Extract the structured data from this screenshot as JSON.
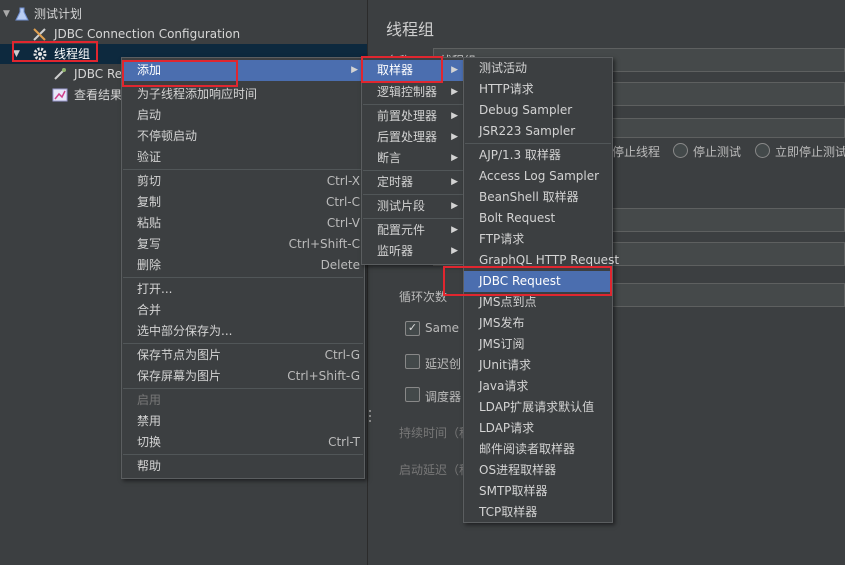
{
  "tree": {
    "items": [
      {
        "label": "测试计划",
        "icon": "flask-icon"
      },
      {
        "label": "JDBC Connection Configuration",
        "icon": "tools-icon"
      },
      {
        "label": "线程组",
        "icon": "gear-icon"
      },
      {
        "label": "JDBC Req",
        "icon": "pipette-icon"
      },
      {
        "label": "查看结果",
        "icon": "chart-icon"
      }
    ]
  },
  "right_panel": {
    "title": "线程组",
    "name_label": "名称",
    "name_value": "线程组",
    "radio_stop_thread": "停止线程",
    "radio_stop_test": "停止测试",
    "radio_stop_now": "立即停止测试",
    "loop_count_label": "循环次数",
    "same_user_label": "Same u",
    "delay_create_label": "延迟创",
    "scheduler_label": "调度器",
    "duration_label": "持续时间（秒",
    "startup_delay_label": "启动延迟（秒"
  },
  "context_menu": {
    "items": [
      {
        "label": "添加",
        "submenu": true
      },
      {
        "label": "为子线程添加响应时间"
      },
      {
        "label": "启动"
      },
      {
        "label": "不停顿启动"
      },
      {
        "label": "验证"
      },
      {
        "label": "剪切",
        "shortcut": "Ctrl-X"
      },
      {
        "label": "复制",
        "shortcut": "Ctrl-C"
      },
      {
        "label": "粘贴",
        "shortcut": "Ctrl-V"
      },
      {
        "label": "复写",
        "shortcut": "Ctrl+Shift-C"
      },
      {
        "label": "删除",
        "shortcut": "Delete"
      },
      {
        "label": "打开..."
      },
      {
        "label": "合并"
      },
      {
        "label": "选中部分保存为..."
      },
      {
        "label": "保存节点为图片",
        "shortcut": "Ctrl-G"
      },
      {
        "label": "保存屏幕为图片",
        "shortcut": "Ctrl+Shift-G"
      },
      {
        "label": "启用"
      },
      {
        "label": "禁用"
      },
      {
        "label": "切换",
        "shortcut": "Ctrl-T"
      },
      {
        "label": "帮助"
      }
    ]
  },
  "add_submenu": {
    "items": [
      {
        "label": "取样器"
      },
      {
        "label": "逻辑控制器"
      },
      {
        "label": "前置处理器"
      },
      {
        "label": "后置处理器"
      },
      {
        "label": "断言"
      },
      {
        "label": "定时器"
      },
      {
        "label": "测试片段"
      },
      {
        "label": "配置元件"
      },
      {
        "label": "监听器"
      }
    ]
  },
  "sampler_submenu": {
    "items": [
      {
        "label": "测试活动"
      },
      {
        "label": "HTTP请求"
      },
      {
        "label": "Debug Sampler"
      },
      {
        "label": "JSR223 Sampler"
      },
      {
        "label": "AJP/1.3 取样器"
      },
      {
        "label": "Access Log Sampler"
      },
      {
        "label": "BeanShell 取样器"
      },
      {
        "label": "Bolt Request"
      },
      {
        "label": "FTP请求"
      },
      {
        "label": "GraphQL HTTP Request"
      },
      {
        "label": "JDBC Request"
      },
      {
        "label": "JMS点到点"
      },
      {
        "label": "JMS发布"
      },
      {
        "label": "JMS订阅"
      },
      {
        "label": "JUnit请求"
      },
      {
        "label": "Java请求"
      },
      {
        "label": "LDAP扩展请求默认值"
      },
      {
        "label": "LDAP请求"
      },
      {
        "label": "邮件阅读者取样器"
      },
      {
        "label": "OS进程取样器"
      },
      {
        "label": "SMTP取样器"
      },
      {
        "label": "TCP取样器"
      }
    ]
  },
  "colors": {
    "highlight": "#4b6eaf",
    "annotation_red": "#e0262f",
    "background": "#3c3f41"
  }
}
